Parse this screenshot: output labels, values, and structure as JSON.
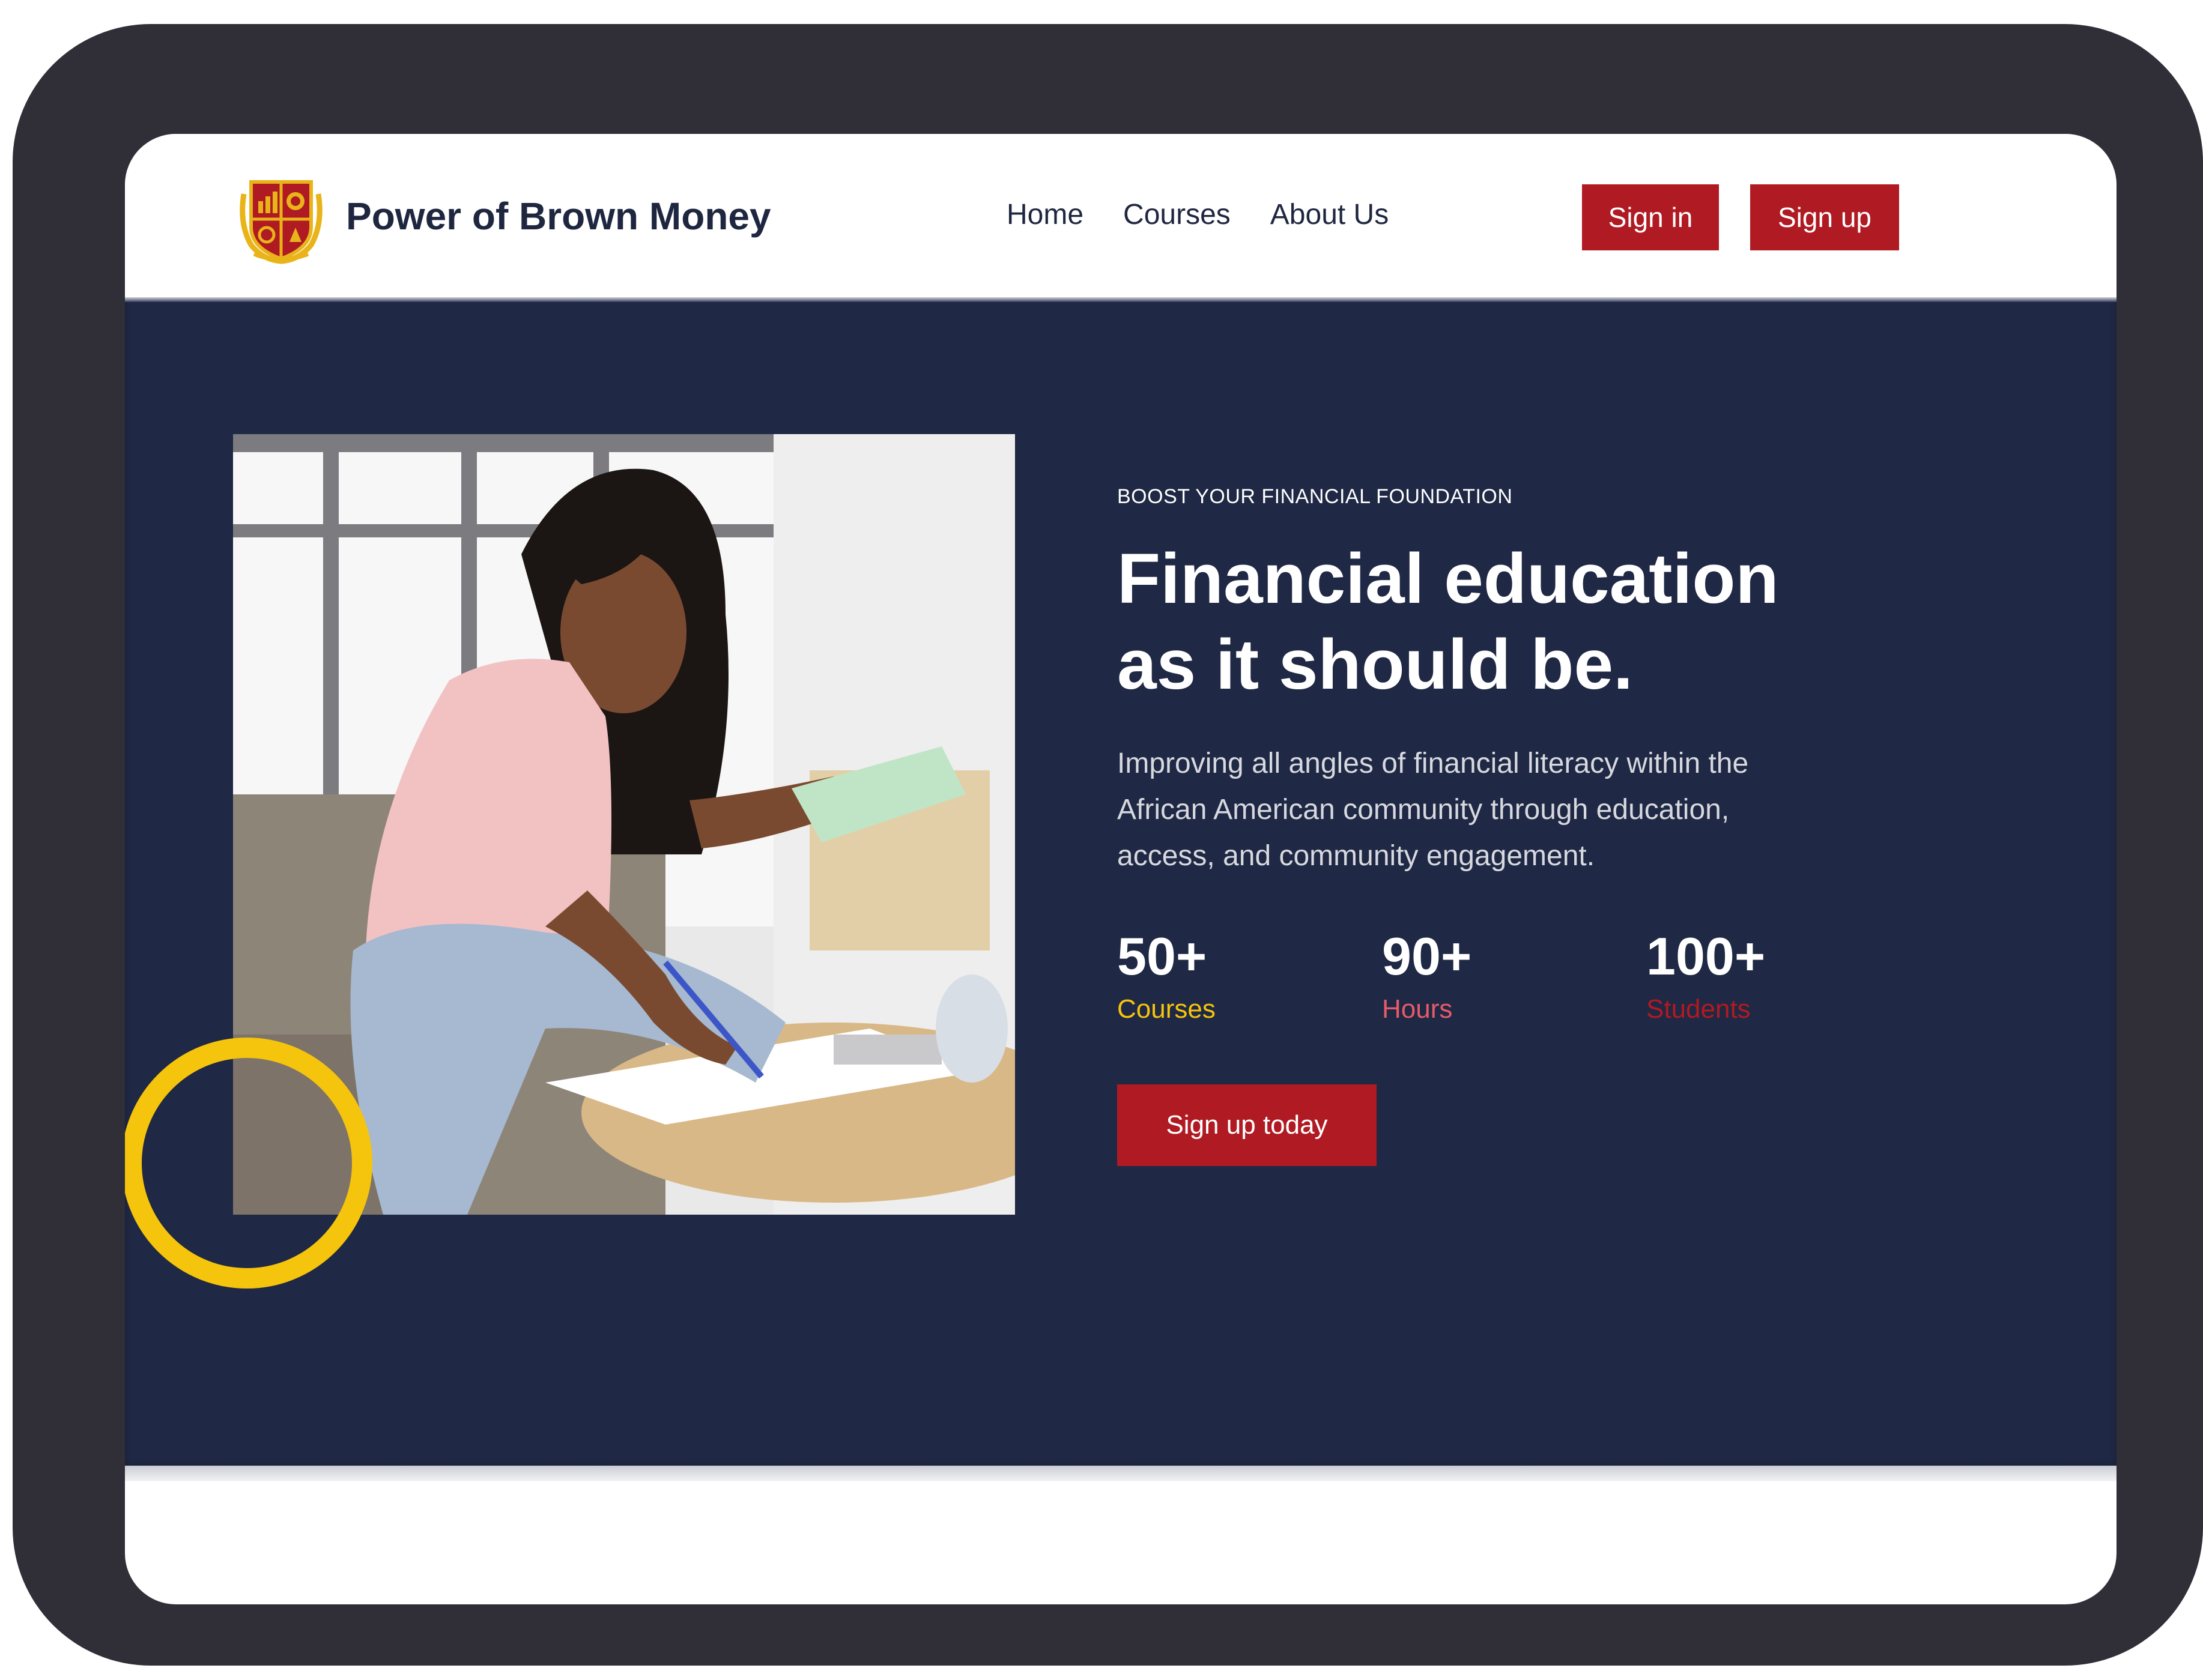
{
  "brand": {
    "name": "Power of Brown Money",
    "crest_colors": {
      "shield": "#b01a22",
      "gold": "#e9b419"
    }
  },
  "nav": {
    "links": [
      {
        "label": "Home",
        "icon": null
      },
      {
        "label": "Courses",
        "icon": null
      },
      {
        "label": "About Us",
        "icon": null
      }
    ],
    "signin_label": "Sign in",
    "signup_label": "Sign up"
  },
  "hero": {
    "eyebrow": "BOOST YOUR FINANCIAL FOUNDATION",
    "headline_lines": [
      "Financial education",
      "as it should be."
    ],
    "subtext_lines": [
      "Improving all angles of financial literacy within the",
      "African American community through education,",
      "access, and community engagement."
    ],
    "stats": [
      {
        "value": "50+",
        "label": "Courses",
        "color": "#f5c40c"
      },
      {
        "value": "90+",
        "label": "Hours",
        "color": "#e65b6a"
      },
      {
        "value": "100+",
        "label": "Students",
        "color": "#b01a22"
      }
    ],
    "cta_label": "Sign up today"
  },
  "colors": {
    "accent_red": "#b01a22",
    "navy": "#1f2844",
    "ring_yellow": "#f5c40c",
    "bezel": "#302f38"
  }
}
